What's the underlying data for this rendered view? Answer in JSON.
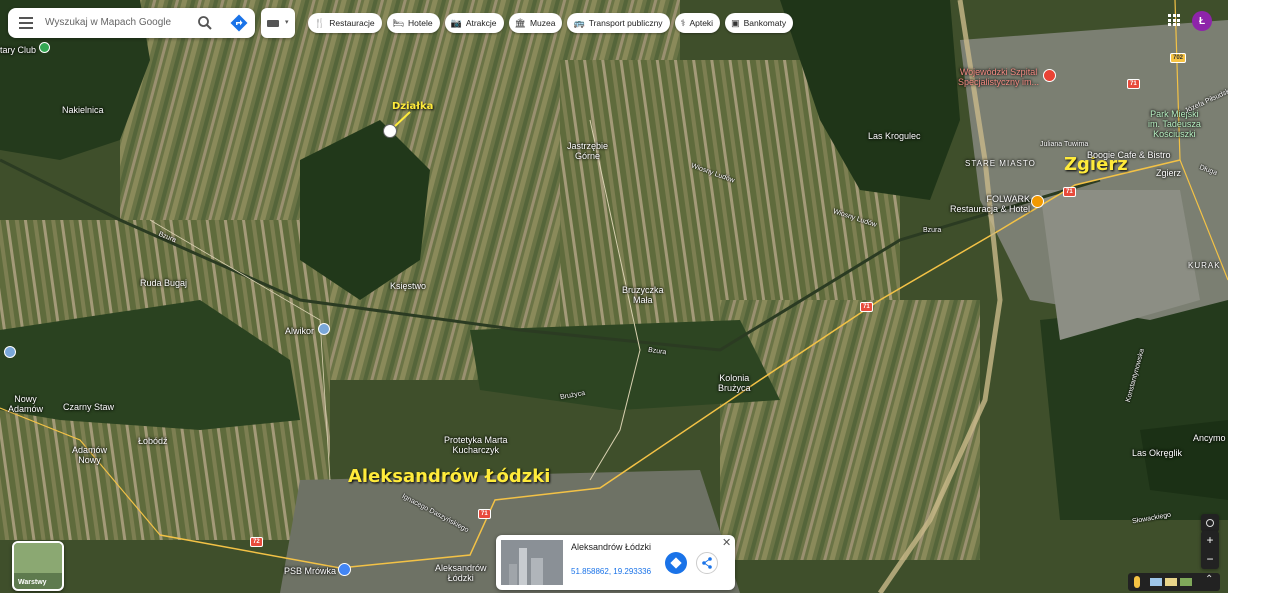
{
  "search": {
    "placeholder": "Wyszukaj w Mapach Google"
  },
  "chips": [
    {
      "label": "Restauracje",
      "icon": "utensils-icon"
    },
    {
      "label": "Hotele",
      "icon": "bed-icon"
    },
    {
      "label": "Atrakcje",
      "icon": "camera-icon"
    },
    {
      "label": "Muzea",
      "icon": "museum-icon"
    },
    {
      "label": "Transport publiczny",
      "icon": "bus-icon"
    },
    {
      "label": "Apteki",
      "icon": "pharmacy-icon"
    },
    {
      "label": "Bankomaty",
      "icon": "atm-icon"
    }
  ],
  "account": {
    "initial": "Ł",
    "color": "#8e24aa"
  },
  "annotations": {
    "plot": "Działka",
    "town": "Aleksandrów Łódzki",
    "city": "Zgierz"
  },
  "places": {
    "tary_club": "tary Club",
    "nakielnica": "Nakielnica",
    "jastrzebie": "Jastrzębie\nGórne",
    "las_krogulec": "Las Krogulec",
    "szpital": "Wojewódzki Szpital\nSpecjalistyczny im...",
    "park": "Park Miejski\nim. Tadeusza\nKościuszki",
    "stare_miasto": "STARE MIASTO",
    "boogie": "Boogie Cafe & Bistro",
    "folwark": "FOLWARK\nRestauracja & Hotel",
    "ruda_bugaj": "Ruda Bugaj",
    "ksiestwo": "Księstwo",
    "bruzyczka": "Bruzyczka\nMała",
    "alwikor": "Alwikor",
    "kolonia": "Kolonia\nBrużyca",
    "kurak": "KURAK",
    "nowy_adamow": "Nowy\nAdamów",
    "czarny_staw": "Czarny Staw",
    "lobodz": "Łobódź",
    "adamow_nowy": "Adamów\nNowy",
    "protetyka": "Protetyka Marta\nKucharczyk",
    "ancymon": "Ancymo",
    "las_okreglik": "Las Okręglik",
    "psb": "PSB Mrówka",
    "aleksandrow_small": "Aleksandrów\nŁódzki",
    "zgierz_small": "Zgierz"
  },
  "roads": {
    "bzura1": "Bzura",
    "bzura2": "Bzura",
    "bzura3": "Bzura",
    "wiosny1": "Wiosny Ludów",
    "wiosny2": "Wiosny Ludów",
    "bruzyca": "Brużyca",
    "tuwima": "Juliana Tuwima",
    "ignacego": "Ignacego Daszyńskiego",
    "slowackiego": "Słowackiego",
    "jozefa": "Józefa Piłsudsk",
    "dluga": "Długa",
    "konstantynowska": "Konstantynowska"
  },
  "shields": [
    "71",
    "71",
    "71",
    "71",
    "72",
    "702"
  ],
  "card": {
    "title": "Aleksandrów Łódzki",
    "coords": "51.858862, 19.293336"
  },
  "layers": {
    "label": "Warstwy"
  }
}
